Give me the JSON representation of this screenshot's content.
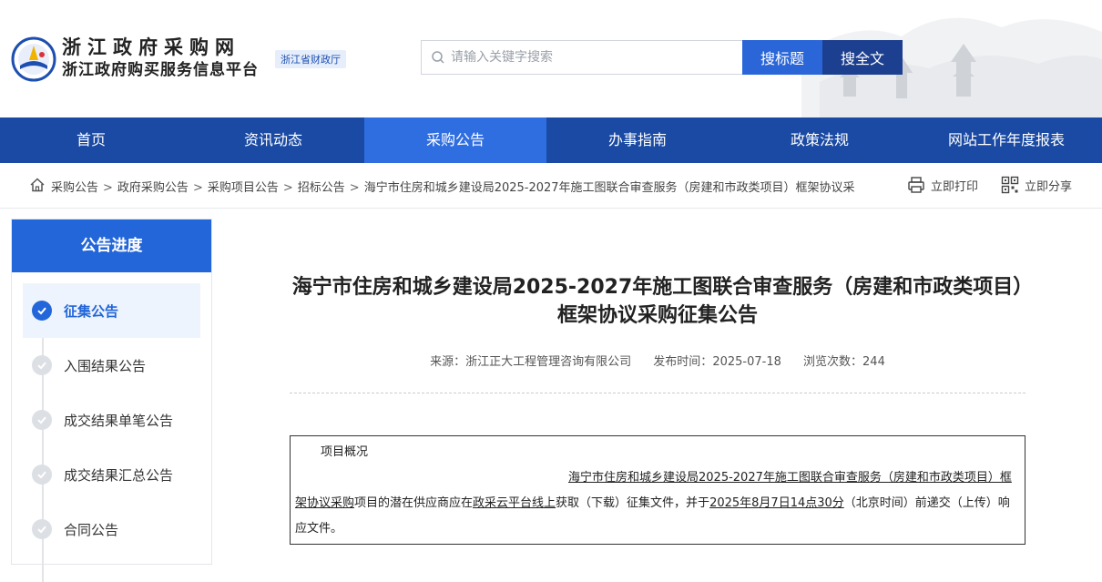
{
  "header": {
    "site_name_line1": "浙江政府采购网",
    "site_name_line2": "浙江政府购买服务信息平台",
    "dept_badge": "浙江省财政厅",
    "search_placeholder": "请输入关键字搜索",
    "search_title_button": "搜标题",
    "search_fulltext_button": "搜全文"
  },
  "nav": {
    "items": [
      {
        "label": "首页"
      },
      {
        "label": "资讯动态"
      },
      {
        "label": "采购公告"
      },
      {
        "label": "办事指南"
      },
      {
        "label": "政策法规"
      },
      {
        "label": "网站工作年度报表"
      }
    ],
    "active_index": 2
  },
  "breadcrumb": {
    "items": [
      "采购公告",
      "政府采购公告",
      "采购项目公告",
      "招标公告",
      "海宁市住房和城乡建设局2025-2027年施工图联合审查服务（房建和市政类项目）框架协议采"
    ],
    "separator": ">",
    "print_label": "立即打印",
    "share_label": "立即分享"
  },
  "sidebar": {
    "title": "公告进度",
    "steps": [
      {
        "label": "征集公告"
      },
      {
        "label": "入围结果公告"
      },
      {
        "label": "成交结果单笔公告"
      },
      {
        "label": "成交结果汇总公告"
      },
      {
        "label": "合同公告"
      }
    ]
  },
  "article": {
    "title": "海宁市住房和城乡建设局2025-2027年施工图联合审查服务（房建和市政类项目）框架协议采购征集公告",
    "source_label": "来源：",
    "source": "浙江正大工程管理咨询有限公司",
    "publish_label": "发布时间：",
    "publish_date": "2025-07-18",
    "views_label": "浏览次数：",
    "views": "244",
    "section_title": "项目概况",
    "body_project_name": "海宁市住房和城乡建设局2025-2027年施工图联合审查服务（房建和市政类项目）框架协议采购",
    "body_part1": "项目的潜在供应商应在",
    "body_platform": "政采云平台线上",
    "body_part2": "获取（下载）征集文件，并于",
    "body_deadline": "2025年8月7日14点30分",
    "body_part3": "（北京时间）前递交（上传）响应文件。"
  },
  "colors": {
    "nav_bg": "#1a4aa3",
    "nav_active": "#2f6ee0",
    "accent": "#2366d9",
    "search_full_bg": "#1d3f8f"
  }
}
